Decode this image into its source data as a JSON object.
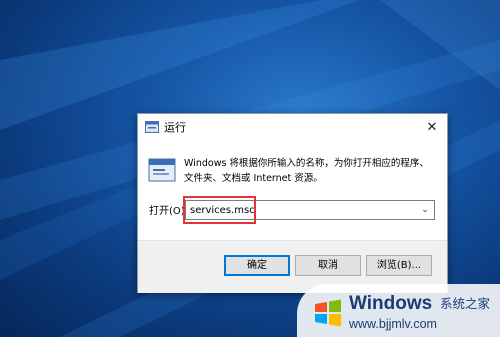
{
  "dialog": {
    "title": "运行",
    "close_glyph": "✕",
    "description": "Windows 将根据你所输入的名称，为你打开相应的程序、文件夹、文档或 Internet 资源。",
    "open_label": "打开(O):",
    "command_value": "services.msc",
    "dropdown_glyph": "⌄",
    "buttons": {
      "ok": "确定",
      "cancel": "取消",
      "browse": "浏览(B)..."
    }
  },
  "watermark": {
    "brand": "Windows",
    "brand_cn": "系统之家",
    "url": "www.bjjmlv.com"
  },
  "colors": {
    "highlight_box": "#e0343a",
    "ok_border": "#0078d7",
    "desktop": "#1656a6"
  },
  "icons": {
    "title": "run-app-icon",
    "dialog": "run-app-icon",
    "close": "close-icon",
    "dropdown": "chevron-down-icon",
    "watermark": "windows-logo-icon"
  }
}
